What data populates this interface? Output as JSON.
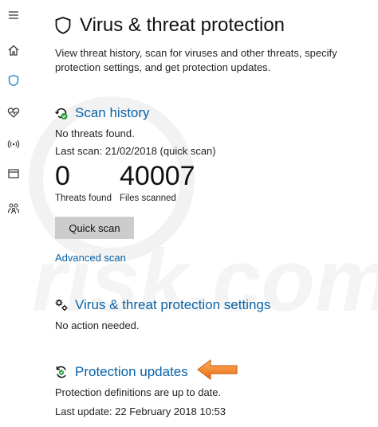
{
  "sidebar": {
    "items": [
      {
        "icon": "hamburger-menu-icon"
      },
      {
        "icon": "home-icon"
      },
      {
        "icon": "shield-icon",
        "active": true
      },
      {
        "icon": "heart-pulse-icon"
      },
      {
        "icon": "wireless-antenna-icon"
      },
      {
        "icon": "browser-window-icon"
      },
      {
        "icon": "family-icon"
      }
    ]
  },
  "header": {
    "title": "Virus & threat protection",
    "description": "View threat history, scan for viruses and other threats, specify protection settings, and get protection updates."
  },
  "scan_history": {
    "title": "Scan history",
    "status": "No threats found.",
    "last_scan": "Last scan: 21/02/2018 (quick scan)",
    "threats_found_value": "0",
    "threats_found_label": "Threats found",
    "files_scanned_value": "40007",
    "files_scanned_label": "Files scanned",
    "quick_scan_label": "Quick scan",
    "advanced_scan_label": "Advanced scan"
  },
  "settings": {
    "title": "Virus & threat protection settings",
    "status": "No action needed."
  },
  "updates": {
    "title": "Protection updates",
    "status": "Protection definitions are up to date.",
    "last_update": "Last update: 22 February 2018 10:53"
  },
  "colors": {
    "accent": "#0a63a8",
    "sidebar_active": "#1e88c8",
    "ok_green": "#2e9e3e",
    "arrow_orange": "#f07c1e"
  }
}
